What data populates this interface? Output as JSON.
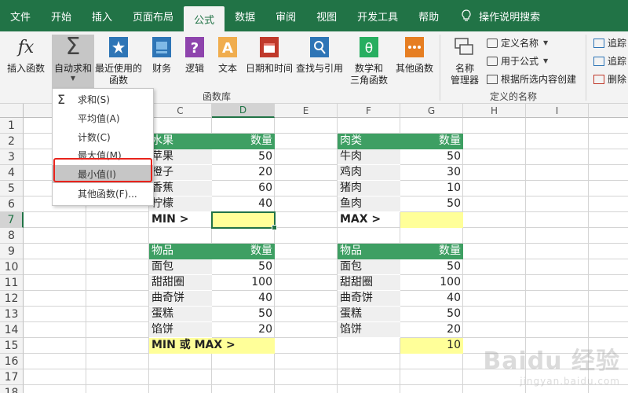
{
  "tabs": [
    "文件",
    "开始",
    "插入",
    "页面布局",
    "公式",
    "数据",
    "审阅",
    "视图",
    "开发工具",
    "帮助"
  ],
  "active_tab": "公式",
  "tell_me": "操作说明搜索",
  "ribbon": {
    "insert_function": "插入函数",
    "autosum": "自动求和",
    "recent": [
      "最近使用的",
      "函数"
    ],
    "financial": "财务",
    "logical": "逻辑",
    "text": "文本",
    "datetime": "日期和时间",
    "lookup": "查找与引用",
    "math": [
      "数学和",
      "三角函数"
    ],
    "more": "其他函数",
    "function_library": "函数库",
    "name_manager": [
      "名称",
      "管理器"
    ],
    "define_name": "定义名称",
    "use_in_formula": "用于公式",
    "create_from_selection": "根据所选内容创建",
    "defined_names": "定义的名称",
    "trace_precedents": "追踪",
    "trace_dependents": "追踪",
    "remove_arrows": "删除"
  },
  "dropdown": {
    "items": [
      "求和(S)",
      "平均值(A)",
      "计数(C)",
      "最大值(M)",
      "最小值(I)",
      "其他函数(F)..."
    ],
    "highlighted_index": 4
  },
  "columns": [
    "",
    "",
    "C",
    "D",
    "E",
    "F",
    "G",
    "H",
    "I",
    ""
  ],
  "rows": [
    "1",
    "2",
    "3",
    "4",
    "5",
    "6",
    "7",
    "8",
    "9",
    "10",
    "11",
    "12",
    "13",
    "14",
    "15",
    "16",
    "17",
    "18"
  ],
  "fruit_table": {
    "headers": [
      "水果",
      "数量"
    ],
    "rows": [
      [
        "苹果",
        "50"
      ],
      [
        "橙子",
        "20"
      ],
      [
        "香蕉",
        "60"
      ],
      [
        "柠檬",
        "40"
      ]
    ],
    "result_label": "MIN >",
    "result_value": ""
  },
  "meat_table": {
    "headers": [
      "肉类",
      "数量"
    ],
    "rows": [
      [
        "牛肉",
        "50"
      ],
      [
        "鸡肉",
        "30"
      ],
      [
        "猪肉",
        "10"
      ],
      [
        "鱼肉",
        "50"
      ]
    ],
    "result_label": "MAX >",
    "result_value": ""
  },
  "item_table_1": {
    "headers": [
      "物品",
      "数量"
    ],
    "rows": [
      [
        "面包",
        "50"
      ],
      [
        "甜甜圈",
        "100"
      ],
      [
        "曲奇饼",
        "40"
      ],
      [
        "蛋糕",
        "50"
      ],
      [
        "馅饼",
        "20"
      ]
    ],
    "result_label": "MIN 或 MAX >"
  },
  "item_table_2": {
    "headers": [
      "物品",
      "数量"
    ],
    "rows": [
      [
        "面包",
        "50"
      ],
      [
        "甜甜圈",
        "100"
      ],
      [
        "曲奇饼",
        "40"
      ],
      [
        "蛋糕",
        "50"
      ],
      [
        "馅饼",
        "20"
      ]
    ],
    "result_value": "10"
  },
  "watermark": {
    "main": "Baidu 经验",
    "sub": "jingyan.baidu.com"
  },
  "colors": {
    "excel_green": "#217346",
    "header_green": "#3e9f63",
    "highlight_yellow": "#ffff99",
    "red_box": "#e8231c"
  }
}
